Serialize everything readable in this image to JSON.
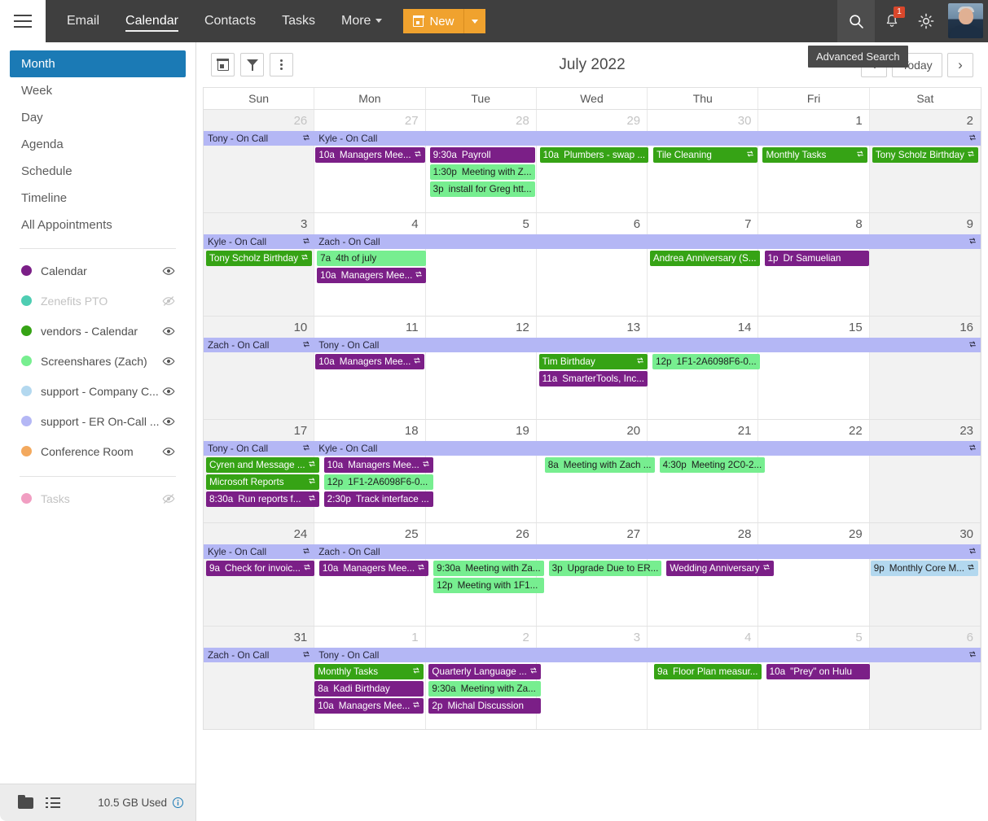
{
  "topbar": {
    "menu_icon": "hamburger-icon",
    "nav": [
      {
        "label": "Email",
        "active": false
      },
      {
        "label": "Calendar",
        "active": true
      },
      {
        "label": "Contacts",
        "active": false
      },
      {
        "label": "Tasks",
        "active": false
      },
      {
        "label": "More",
        "active": false,
        "has_caret": true
      }
    ],
    "new_button": {
      "label": "New",
      "icon": "calendar-icon",
      "color": "#f0a22e"
    },
    "icons": [
      "search-icon",
      "bell-icon",
      "brightness-icon",
      "avatar"
    ],
    "notification_count": "1",
    "tooltip": "Advanced Search"
  },
  "sidebar": {
    "views": [
      {
        "label": "Month",
        "active": true
      },
      {
        "label": "Week",
        "active": false
      },
      {
        "label": "Day",
        "active": false
      },
      {
        "label": "Agenda",
        "active": false
      },
      {
        "label": "Schedule",
        "active": false
      },
      {
        "label": "Timeline",
        "active": false
      },
      {
        "label": "All Appointments",
        "active": false
      }
    ],
    "calendars": [
      {
        "label": "Calendar",
        "color": "#7b1f87",
        "visible": true
      },
      {
        "label": "Zenefits PTO",
        "color": "#4ecdb2",
        "visible": false
      },
      {
        "label": "vendors - Calendar",
        "color": "#36a315",
        "visible": true
      },
      {
        "label": "Screenshares (Zach)",
        "color": "#77ee90",
        "visible": true
      },
      {
        "label": "support - Company C...",
        "color": "#b3d8ef",
        "visible": true
      },
      {
        "label": "support - ER On-Call ...",
        "color": "#b4b7f5",
        "visible": true
      },
      {
        "label": "Conference Room",
        "color": "#f3a95e",
        "visible": true
      }
    ],
    "tasks": {
      "label": "Tasks",
      "color": "#f19ec2",
      "visible": false
    }
  },
  "statusbar": {
    "folder_icon": "folder-icon",
    "list_icon": "list-icon",
    "storage": "10.5 GB Used",
    "info_icon": "info-icon"
  },
  "toolbar": {
    "buttons": [
      "calendar-icon",
      "filter-icon",
      "more-vertical-icon"
    ],
    "title": "July 2022",
    "prev": "‹",
    "today": "Today",
    "next": "›"
  },
  "grid": {
    "day_headers": [
      "Sun",
      "Mon",
      "Tue",
      "Wed",
      "Thu",
      "Fri",
      "Sat"
    ],
    "colors": {
      "calendar_purple": "#7b1f87",
      "vendors_green": "#36a315",
      "screenshares_green": "#77ee90",
      "oncall_lavender": "#b4b7f5",
      "company_blue": "#b3d8ef"
    },
    "weeks": [
      {
        "days": [
          {
            "num": "26",
            "other": true,
            "weekend": true
          },
          {
            "num": "27",
            "other": true,
            "weekend": false
          },
          {
            "num": "28",
            "other": true,
            "weekend": false
          },
          {
            "num": "29",
            "other": true,
            "weekend": false
          },
          {
            "num": "30",
            "other": true,
            "weekend": false
          },
          {
            "num": "1",
            "other": false,
            "weekend": false
          },
          {
            "num": "2",
            "other": false,
            "weekend": true
          }
        ],
        "bands": [
          {
            "label": "Tony - On Call",
            "start": 0,
            "span": 1,
            "recurring": true
          },
          {
            "label": "Kyle - On Call",
            "start": 1,
            "span": 6,
            "recurring": true
          }
        ],
        "events": [
          [],
          [
            {
              "time": "10a",
              "title": "Managers Mee...",
              "color": "#7b1f87",
              "text": "light",
              "recurring": true
            }
          ],
          [
            {
              "time": "9:30a",
              "title": "Payroll",
              "color": "#7b1f87",
              "text": "light",
              "recurring": false
            },
            {
              "time": "1:30p",
              "title": "Meeting with Z...",
              "color": "#77ee90",
              "text": "dark",
              "recurring": false
            },
            {
              "time": "3p",
              "title": "install for Greg htt...",
              "color": "#77ee90",
              "text": "dark",
              "recurring": false
            }
          ],
          [
            {
              "time": "10a",
              "title": "Plumbers - swap ...",
              "color": "#36a315",
              "text": "light",
              "recurring": false
            }
          ],
          [
            {
              "time": "",
              "title": "Tile Cleaning",
              "color": "#36a315",
              "text": "light",
              "recurring": true
            }
          ],
          [
            {
              "time": "",
              "title": "Monthly Tasks",
              "color": "#36a315",
              "text": "light",
              "recurring": true
            }
          ],
          [
            {
              "time": "",
              "title": "Tony Scholz Birthday",
              "color": "#36a315",
              "text": "light",
              "recurring": true
            }
          ]
        ]
      },
      {
        "days": [
          {
            "num": "3",
            "other": false,
            "weekend": true
          },
          {
            "num": "4",
            "other": false,
            "weekend": false
          },
          {
            "num": "5",
            "other": false,
            "weekend": false
          },
          {
            "num": "6",
            "other": false,
            "weekend": false
          },
          {
            "num": "7",
            "other": false,
            "weekend": false
          },
          {
            "num": "8",
            "other": false,
            "weekend": false
          },
          {
            "num": "9",
            "other": false,
            "weekend": true
          }
        ],
        "bands": [
          {
            "label": "Kyle - On Call",
            "start": 0,
            "span": 1,
            "recurring": true
          },
          {
            "label": "Zach - On Call",
            "start": 1,
            "span": 6,
            "recurring": true
          }
        ],
        "events": [
          [
            {
              "time": "",
              "title": "Tony Scholz Birthday",
              "color": "#36a315",
              "text": "light",
              "recurring": true
            }
          ],
          [
            {
              "time": "7a",
              "title": "4th of july",
              "color": "#77ee90",
              "text": "dark",
              "recurring": false
            },
            {
              "time": "10a",
              "title": "Managers Mee...",
              "color": "#7b1f87",
              "text": "light",
              "recurring": true
            }
          ],
          [],
          [],
          [
            {
              "time": "",
              "title": "Andrea Anniversary (S...",
              "color": "#36a315",
              "text": "light",
              "recurring": false
            }
          ],
          [
            {
              "time": "1p",
              "title": "Dr Samuelian",
              "color": "#7b1f87",
              "text": "light",
              "recurring": false
            }
          ],
          []
        ]
      },
      {
        "days": [
          {
            "num": "10",
            "other": false,
            "weekend": true
          },
          {
            "num": "11",
            "other": false,
            "weekend": false
          },
          {
            "num": "12",
            "other": false,
            "weekend": false
          },
          {
            "num": "13",
            "other": false,
            "weekend": false
          },
          {
            "num": "14",
            "other": false,
            "weekend": false
          },
          {
            "num": "15",
            "other": false,
            "weekend": false
          },
          {
            "num": "16",
            "other": false,
            "weekend": true
          }
        ],
        "bands": [
          {
            "label": "Zach - On Call",
            "start": 0,
            "span": 1,
            "recurring": true
          },
          {
            "label": "Tony - On Call",
            "start": 1,
            "span": 6,
            "recurring": true
          }
        ],
        "events": [
          [],
          [
            {
              "time": "10a",
              "title": "Managers Mee...",
              "color": "#7b1f87",
              "text": "light",
              "recurring": true
            }
          ],
          [],
          [
            {
              "time": "",
              "title": "Tim Birthday",
              "color": "#36a315",
              "text": "light",
              "recurring": true
            },
            {
              "time": "11a",
              "title": "SmarterTools, Inc...",
              "color": "#7b1f87",
              "text": "light",
              "recurring": false
            }
          ],
          [
            {
              "time": "12p",
              "title": "1F1-2A6098F6-0...",
              "color": "#77ee90",
              "text": "dark",
              "recurring": false
            }
          ],
          [],
          []
        ]
      },
      {
        "days": [
          {
            "num": "17",
            "other": false,
            "weekend": true
          },
          {
            "num": "18",
            "other": false,
            "weekend": false
          },
          {
            "num": "19",
            "other": false,
            "weekend": false
          },
          {
            "num": "20",
            "other": false,
            "weekend": false
          },
          {
            "num": "21",
            "other": false,
            "weekend": false
          },
          {
            "num": "22",
            "other": false,
            "weekend": false
          },
          {
            "num": "23",
            "other": false,
            "weekend": true
          }
        ],
        "bands": [
          {
            "label": "Tony - On Call",
            "start": 0,
            "span": 1,
            "recurring": true
          },
          {
            "label": "Kyle - On Call",
            "start": 1,
            "span": 6,
            "recurring": true
          }
        ],
        "events": [
          [
            {
              "time": "",
              "title": "Cyren and Message ...",
              "color": "#36a315",
              "text": "light",
              "recurring": true
            },
            {
              "time": "",
              "title": "Microsoft Reports",
              "color": "#36a315",
              "text": "light",
              "recurring": true
            },
            {
              "time": "8:30a",
              "title": "Run reports f...",
              "color": "#7b1f87",
              "text": "light",
              "recurring": true
            }
          ],
          [
            {
              "time": "10a",
              "title": "Managers Mee...",
              "color": "#7b1f87",
              "text": "light",
              "recurring": true
            },
            {
              "time": "12p",
              "title": "1F1-2A6098F6-0...",
              "color": "#77ee90",
              "text": "dark",
              "recurring": false
            },
            {
              "time": "2:30p",
              "title": "Track interface ...",
              "color": "#7b1f87",
              "text": "light",
              "recurring": false
            }
          ],
          [],
          [
            {
              "time": "8a",
              "title": "Meeting with Zach ...",
              "color": "#77ee90",
              "text": "dark",
              "recurring": false
            }
          ],
          [
            {
              "time": "4:30p",
              "title": "Meeting 2C0-2...",
              "color": "#77ee90",
              "text": "dark",
              "recurring": false
            }
          ],
          [],
          []
        ]
      },
      {
        "days": [
          {
            "num": "24",
            "other": false,
            "weekend": true
          },
          {
            "num": "25",
            "other": false,
            "weekend": false
          },
          {
            "num": "26",
            "other": false,
            "weekend": false
          },
          {
            "num": "27",
            "other": false,
            "weekend": false
          },
          {
            "num": "28",
            "other": false,
            "weekend": false
          },
          {
            "num": "29",
            "other": false,
            "weekend": false
          },
          {
            "num": "30",
            "other": false,
            "weekend": true
          }
        ],
        "bands": [
          {
            "label": "Kyle - On Call",
            "start": 0,
            "span": 1,
            "recurring": true
          },
          {
            "label": "Zach - On Call",
            "start": 1,
            "span": 6,
            "recurring": true
          }
        ],
        "events": [
          [
            {
              "time": "9a",
              "title": "Check for invoic...",
              "color": "#7b1f87",
              "text": "light",
              "recurring": true
            }
          ],
          [
            {
              "time": "10a",
              "title": "Managers Mee...",
              "color": "#7b1f87",
              "text": "light",
              "recurring": true
            }
          ],
          [
            {
              "time": "9:30a",
              "title": "Meeting with Za...",
              "color": "#77ee90",
              "text": "dark",
              "recurring": false
            },
            {
              "time": "12p",
              "title": "Meeting with 1F1...",
              "color": "#77ee90",
              "text": "dark",
              "recurring": false
            }
          ],
          [
            {
              "time": "3p",
              "title": "Upgrade Due to ER...",
              "color": "#77ee90",
              "text": "dark",
              "recurring": false
            }
          ],
          [
            {
              "time": "",
              "title": "Wedding Anniversary",
              "color": "#7b1f87",
              "text": "light",
              "recurring": true
            }
          ],
          [],
          [
            {
              "time": "9p",
              "title": "Monthly Core M...",
              "color": "#b3d8ef",
              "text": "dark",
              "recurring": true
            }
          ]
        ]
      },
      {
        "days": [
          {
            "num": "31",
            "other": false,
            "weekend": true
          },
          {
            "num": "1",
            "other": true,
            "weekend": false
          },
          {
            "num": "2",
            "other": true,
            "weekend": false
          },
          {
            "num": "3",
            "other": true,
            "weekend": false
          },
          {
            "num": "4",
            "other": true,
            "weekend": false
          },
          {
            "num": "5",
            "other": true,
            "weekend": false
          },
          {
            "num": "6",
            "other": true,
            "weekend": true
          }
        ],
        "bands": [
          {
            "label": "Zach - On Call",
            "start": 0,
            "span": 1,
            "recurring": true
          },
          {
            "label": "Tony - On Call",
            "start": 1,
            "span": 6,
            "recurring": true
          }
        ],
        "events": [
          [],
          [
            {
              "time": "",
              "title": "Monthly Tasks",
              "color": "#36a315",
              "text": "light",
              "recurring": true
            },
            {
              "time": "8a",
              "title": "Kadi Birthday",
              "color": "#7b1f87",
              "text": "light",
              "recurring": false
            },
            {
              "time": "10a",
              "title": "Managers Mee...",
              "color": "#7b1f87",
              "text": "light",
              "recurring": true
            }
          ],
          [
            {
              "time": "",
              "title": "Quarterly Language ...",
              "color": "#7b1f87",
              "text": "light",
              "recurring": true
            },
            {
              "time": "9:30a",
              "title": "Meeting with Za...",
              "color": "#77ee90",
              "text": "dark",
              "recurring": false
            },
            {
              "time": "2p",
              "title": "Michal Discussion",
              "color": "#7b1f87",
              "text": "light",
              "recurring": false
            }
          ],
          [],
          [
            {
              "time": "9a",
              "title": "Floor Plan measur...",
              "color": "#36a315",
              "text": "light",
              "recurring": false
            }
          ],
          [
            {
              "time": "10a",
              "title": "\"Prey\" on Hulu",
              "color": "#7b1f87",
              "text": "light",
              "recurring": false
            }
          ],
          []
        ]
      }
    ]
  }
}
